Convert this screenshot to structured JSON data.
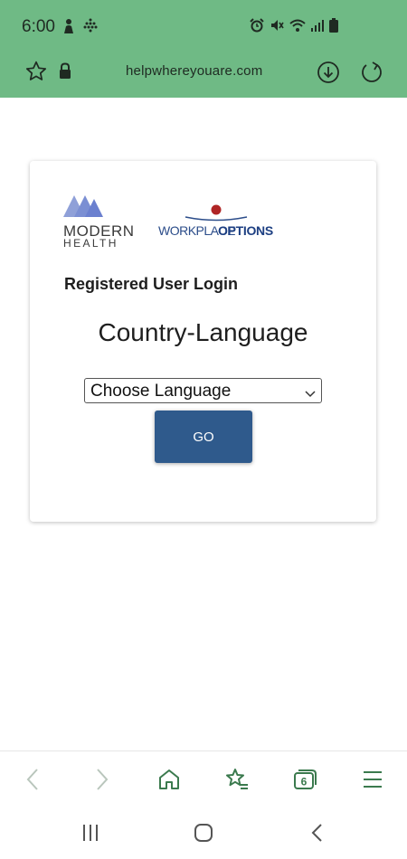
{
  "status_bar": {
    "time": "6:00",
    "left_icons": [
      "notification-person-icon",
      "dotted-grid-icon"
    ],
    "right_icons": [
      "alarm-icon",
      "mute-icon",
      "wifi-icon",
      "signal-icon",
      "battery-icon"
    ]
  },
  "browser": {
    "url": "helpwhereyouare.com",
    "tab_count": "6"
  },
  "logos": {
    "modern_health_line1": "MODERN",
    "modern_health_line2": "HEALTH",
    "workplace_options_part1": "WORKPLACE",
    "workplace_options_part2": "OPTIONS"
  },
  "login": {
    "title": "Registered User Login",
    "heading": "Country-Language",
    "language_select_value": "Choose Language",
    "go_label": "GO"
  },
  "colors": {
    "chrome_green": "#6fba85",
    "go_button": "#2f5a8c",
    "toolbar_icon": "#3b7a4e"
  }
}
